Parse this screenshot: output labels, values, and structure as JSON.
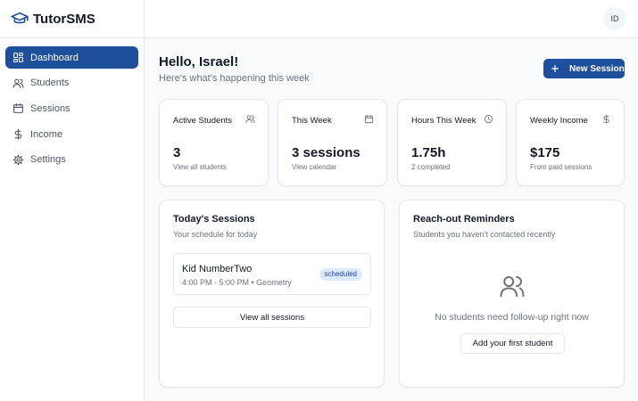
{
  "app": {
    "name": "TutorSMS",
    "logo_icon": "graduation-cap-icon"
  },
  "sidebar": {
    "items": [
      {
        "label": "Dashboard",
        "icon": "dashboard-icon",
        "active": true
      },
      {
        "label": "Students",
        "icon": "users-icon"
      },
      {
        "label": "Sessions",
        "icon": "calendar-icon"
      },
      {
        "label": "Income",
        "icon": "dollar-icon"
      },
      {
        "label": "Settings",
        "icon": "gear-icon"
      }
    ]
  },
  "header": {
    "avatar_initials": "ID"
  },
  "main": {
    "greeting": "Hello, Israel!",
    "subtitle": "Here's what's happening this week",
    "new_session_label": "New Session",
    "stats": [
      {
        "title": "Active Students",
        "value": "3",
        "sub": "View all students",
        "icon": "users-icon"
      },
      {
        "title": "This Week",
        "value": "3 sessions",
        "sub": "View calendar",
        "icon": "calendar-icon"
      },
      {
        "title": "Hours This Week",
        "value": "1.75h",
        "sub": "2 completed",
        "icon": "clock-icon"
      },
      {
        "title": "Weekly Income",
        "value": "$175",
        "sub": "From paid sessions",
        "icon": "dollar-icon"
      }
    ],
    "today_sessions": {
      "title": "Today's Sessions",
      "subtitle": "Your schedule for today",
      "items": [
        {
          "name": "Kid NumberTwo",
          "meta": "4:00 PM - 5:00 PM • Geometry",
          "status": "scheduled"
        }
      ],
      "view_all_label": "View all sessions"
    },
    "reminders": {
      "title": "Reach-out Reminders",
      "subtitle": "Students you haven't contacted recently",
      "empty_text": "No students need follow-up right now",
      "add_label": "Add your first student"
    }
  },
  "colors": {
    "accent": "#1e4f9c",
    "badge_bg": "#dbeafe",
    "badge_text": "#1e40af"
  }
}
